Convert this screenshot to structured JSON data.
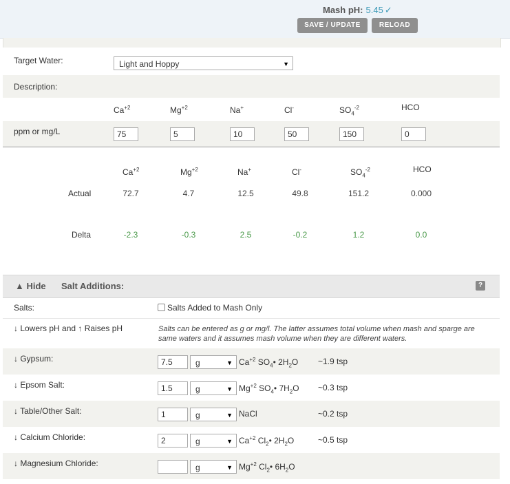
{
  "header": {
    "mash_ph_label": "Mash pH:",
    "mash_ph_value": "5.45",
    "mash_ph_check": "✓",
    "save_update": "SAVE / UPDATE",
    "reload": "RELOAD"
  },
  "target": {
    "target_water_label": "Target Water:",
    "target_water_value": "Light and Hoppy",
    "description_label": "Description:",
    "ppm_label": "ppm or mg/L",
    "ions": [
      {
        "base": "Ca",
        "sup": "+2",
        "sub": "",
        "value": "75"
      },
      {
        "base": "Mg",
        "sup": "+2",
        "sub": "",
        "value": "5"
      },
      {
        "base": "Na",
        "sup": "+",
        "sub": "",
        "value": "10"
      },
      {
        "base": "Cl",
        "sup": "-",
        "sub": "",
        "value": "50"
      },
      {
        "base": "SO",
        "sup": "-2",
        "sub": "4",
        "value": "150"
      },
      {
        "base": "HCO",
        "sup": "",
        "sub": "",
        "value": "0"
      }
    ]
  },
  "results": {
    "ions": [
      {
        "base": "Ca",
        "sup": "+2",
        "sub": ""
      },
      {
        "base": "Mg",
        "sup": "+2",
        "sub": ""
      },
      {
        "base": "Na",
        "sup": "+",
        "sub": ""
      },
      {
        "base": "Cl",
        "sup": "-",
        "sub": ""
      },
      {
        "base": "SO",
        "sup": "-2",
        "sub": "4"
      },
      {
        "base": "HCO",
        "sup": "",
        "sub": ""
      }
    ],
    "actual_label": "Actual",
    "actual": [
      "72.7",
      "4.7",
      "12.5",
      "49.8",
      "151.2",
      "0.000"
    ],
    "delta_label": "Delta",
    "delta": [
      "-2.3",
      "-0.3",
      "2.5",
      "-0.2",
      "1.2",
      "0.0"
    ]
  },
  "salts": {
    "toggle": "▲ Hide",
    "title": "Salt Additions:",
    "help": "?",
    "salts_label": "Salts:",
    "mash_only_label": "Salts Added to Mash Only",
    "ph_label": "↓ Lowers pH and ↑ Raises pH",
    "note": "Salts can be entered as g or mg/l. The latter assumes total volume when mash and sparge are same waters and it assumes mash volume when they are different waters.",
    "items": [
      {
        "label": "↓ Gypsum:",
        "amount": "7.5",
        "unit": "g",
        "tsp": "~1.9 tsp",
        "formula": [
          [
            "Ca",
            "+2",
            ""
          ],
          [
            " SO",
            "",
            "4"
          ],
          [
            "• 2H",
            "",
            "2"
          ],
          [
            "O",
            "",
            ""
          ]
        ]
      },
      {
        "label": "↓ Epsom Salt:",
        "amount": "1.5",
        "unit": "g",
        "tsp": "~0.3 tsp",
        "formula": [
          [
            "Mg",
            "+2",
            ""
          ],
          [
            " SO",
            "",
            "4"
          ],
          [
            "• 7H",
            "",
            "2"
          ],
          [
            "O",
            "",
            ""
          ]
        ]
      },
      {
        "label": "↓ Table/Other Salt:",
        "amount": "1",
        "unit": "g",
        "tsp": "~0.2 tsp",
        "formula": [
          [
            "NaCl",
            "",
            ""
          ]
        ]
      },
      {
        "label": "↓ Calcium Chloride:",
        "amount": "2",
        "unit": "g",
        "tsp": "~0.5 tsp",
        "formula": [
          [
            "Ca",
            "+2",
            ""
          ],
          [
            " Cl",
            "",
            "2"
          ],
          [
            "• 2H",
            "",
            "2"
          ],
          [
            "O",
            "",
            ""
          ]
        ]
      },
      {
        "label": "↓ Magnesium Chloride:",
        "amount": "",
        "unit": "g",
        "tsp": "",
        "formula": [
          [
            "Mg",
            "+2",
            ""
          ],
          [
            " Cl",
            "",
            "2"
          ],
          [
            "• 6H",
            "",
            "2"
          ],
          [
            "O",
            "",
            ""
          ]
        ]
      }
    ]
  }
}
